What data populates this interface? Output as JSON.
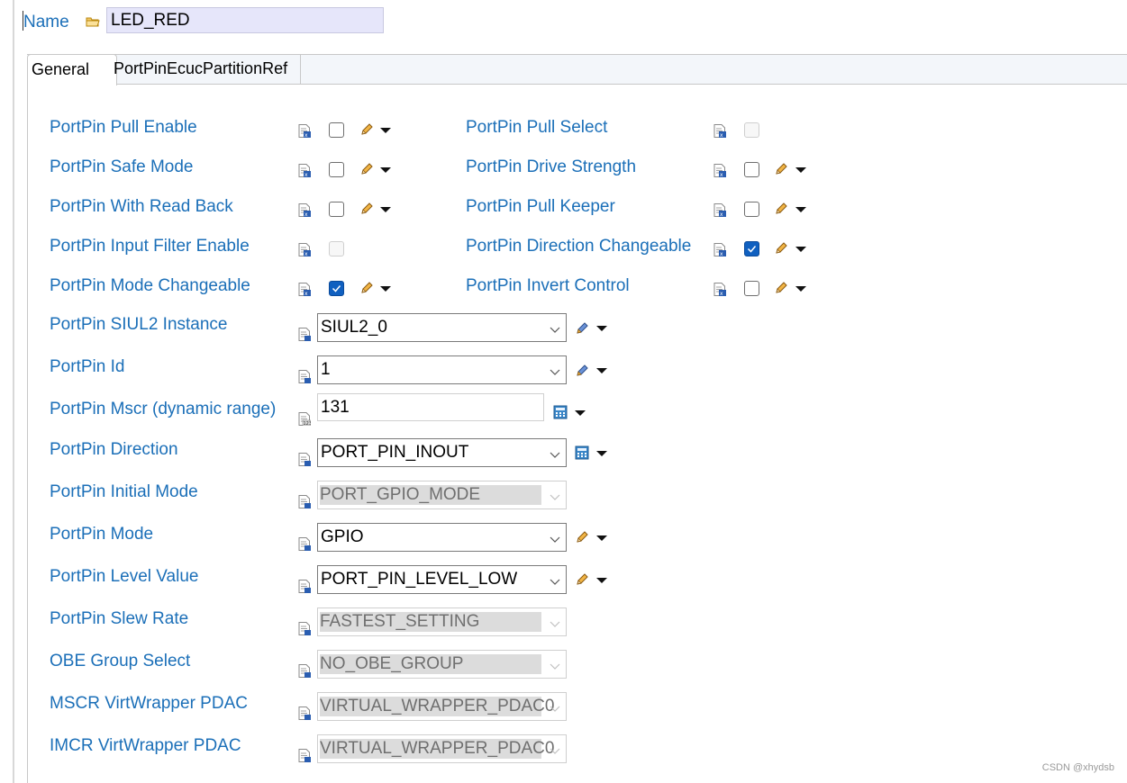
{
  "header": {
    "name_label": "Name",
    "name_value": "LED_RED"
  },
  "tabs": [
    {
      "label": "General",
      "active": true
    },
    {
      "label": "PortPinEcucPartitionRef",
      "active": false
    }
  ],
  "checkbox_params": {
    "left": [
      {
        "label": "PortPin Pull Enable",
        "checked": false,
        "enabled": true
      },
      {
        "label": "PortPin Safe Mode",
        "checked": false,
        "enabled": true
      },
      {
        "label": "PortPin With Read Back",
        "checked": false,
        "enabled": true
      },
      {
        "label": "PortPin Input Filter Enable",
        "checked": false,
        "enabled": false
      },
      {
        "label": "PortPin Mode Changeable",
        "checked": true,
        "enabled": true
      }
    ],
    "right": [
      {
        "label": "PortPin Pull Select",
        "checked": false,
        "enabled": false
      },
      {
        "label": "PortPin Drive Strength",
        "checked": false,
        "enabled": true
      },
      {
        "label": "PortPin Pull Keeper",
        "checked": false,
        "enabled": true
      },
      {
        "label": "PortPin Direction Changeable",
        "checked": true,
        "enabled": true
      },
      {
        "label": "PortPin Invert Control",
        "checked": false,
        "enabled": true
      }
    ]
  },
  "select_params": [
    {
      "label": "PortPin SIUL2 Instance",
      "value": "SIUL2_0",
      "kind": "combo",
      "enabled": true,
      "action": "pencil-alt"
    },
    {
      "label": "PortPin Id",
      "value": "1",
      "kind": "combo",
      "enabled": true,
      "action": "pencil-alt"
    },
    {
      "label": "PortPin Mscr (dynamic range)",
      "value": "131",
      "kind": "text",
      "enabled": true,
      "action": "calc"
    },
    {
      "label": "PortPin Direction",
      "value": "PORT_PIN_INOUT",
      "kind": "combo",
      "enabled": true,
      "action": "calc"
    },
    {
      "label": "PortPin Initial Mode",
      "value": "PORT_GPIO_MODE",
      "kind": "combo",
      "enabled": false,
      "action": "none"
    },
    {
      "label": "PortPin Mode",
      "value": "GPIO",
      "kind": "combo",
      "enabled": true,
      "action": "pencil"
    },
    {
      "label": "PortPin Level Value",
      "value": "PORT_PIN_LEVEL_LOW",
      "kind": "combo",
      "enabled": true,
      "action": "pencil"
    },
    {
      "label": "PortPin Slew Rate",
      "value": "FASTEST_SETTING",
      "kind": "combo",
      "enabled": false,
      "action": "none"
    },
    {
      "label": "OBE Group Select",
      "value": "NO_OBE_GROUP",
      "kind": "combo",
      "enabled": false,
      "action": "none"
    },
    {
      "label": "MSCR VirtWrapper PDAC",
      "value": "VIRTUAL_WRAPPER_PDAC0",
      "kind": "combo",
      "enabled": false,
      "action": "none"
    },
    {
      "label": "IMCR VirtWrapper PDAC",
      "value": "VIRTUAL_WRAPPER_PDAC0",
      "kind": "combo",
      "enabled": false,
      "action": "none"
    }
  ],
  "watermark": "CSDN @xhydsb",
  "colors": {
    "label_blue": "#1b6fb8",
    "name_field_bg": "#e6e6fa",
    "checked_blue": "#1060c0"
  }
}
